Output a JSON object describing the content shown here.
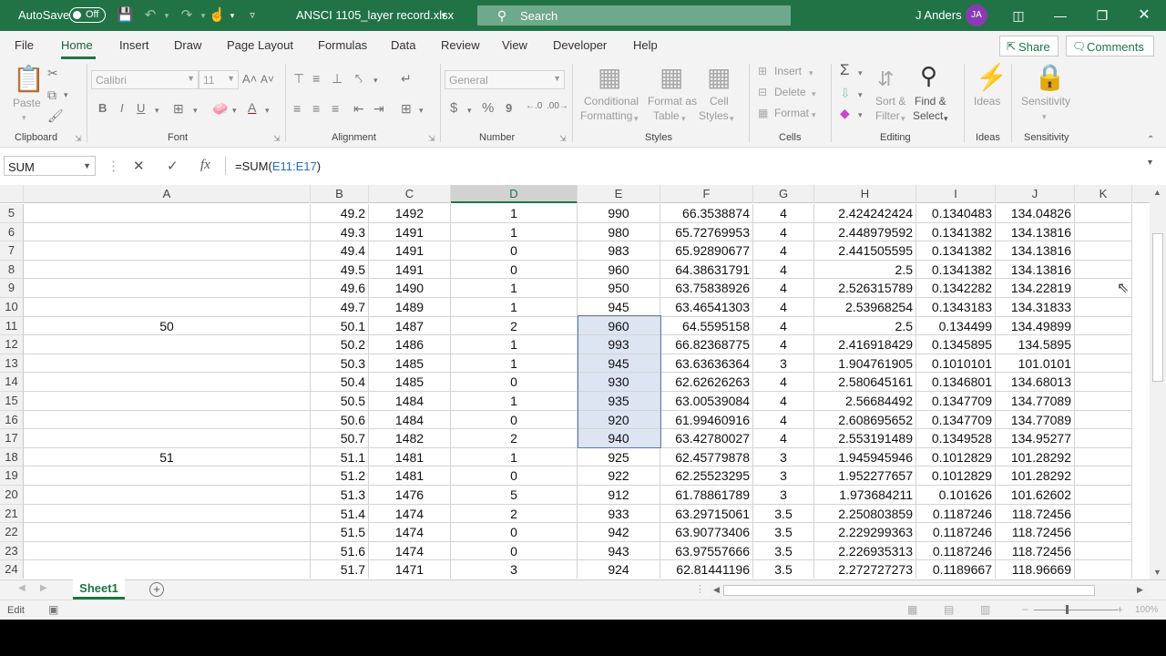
{
  "titlebar": {
    "autosave_label": "AutoSave",
    "autosave_state": "Off",
    "doc_title": "ANSCI 1105_layer record.xlsx",
    "search_placeholder": "Search",
    "user_name": "J Anders",
    "user_initials": "JA",
    "brand_color": "#217346"
  },
  "menu": {
    "tabs": [
      "File",
      "Home",
      "Insert",
      "Draw",
      "Page Layout",
      "Formulas",
      "Data",
      "Review",
      "View",
      "Developer",
      "Help"
    ],
    "active_tab": "Home",
    "share_label": "Share",
    "comments_label": "Comments"
  },
  "ribbon": {
    "clipboard": {
      "paste": "Paste",
      "label": "Clipboard"
    },
    "font": {
      "name": "Calibri",
      "size": "11",
      "label": "Font",
      "bold": "B",
      "italic": "I",
      "underline": "U"
    },
    "alignment": {
      "label": "Alignment"
    },
    "number": {
      "format": "General",
      "label": "Number",
      "currency": "$",
      "percent": "%",
      "comma": "9"
    },
    "styles": {
      "conditional_1": "Conditional",
      "conditional_2": "Formatting",
      "format_table_1": "Format as",
      "format_table_2": "Table",
      "cell_styles_1": "Cell",
      "cell_styles_2": "Styles",
      "label": "Styles"
    },
    "cells": {
      "insert": "Insert",
      "delete": "Delete",
      "format": "Format",
      "label": "Cells"
    },
    "editing": {
      "sort_1": "Sort &",
      "sort_2": "Filter",
      "find_1": "Find &",
      "find_2": "Select",
      "label": "Editing"
    },
    "ideas": {
      "button": "Ideas",
      "label": "Ideas"
    },
    "sensitivity": {
      "button": "Sensitivity",
      "label": "Sensitivity"
    }
  },
  "formula_bar": {
    "name_box": "SUM",
    "formula_prefix": "=SUM(",
    "formula_ref": "E11:E17",
    "formula_suffix": ")",
    "fx": "fx"
  },
  "sheet": {
    "columns": [
      "A",
      "B",
      "C",
      "D",
      "E",
      "F",
      "G",
      "H",
      "I",
      "J",
      "K"
    ],
    "selected_column": "D",
    "rows": [
      {
        "n": "5",
        "A": "",
        "B": "49.2",
        "C": "1492",
        "D": "1",
        "E": "990",
        "F": "66.3538874",
        "G": "4",
        "H": "2.424242424",
        "I": "0.1340483",
        "J": "134.04826"
      },
      {
        "n": "6",
        "A": "",
        "B": "49.3",
        "C": "1491",
        "D": "1",
        "E": "980",
        "F": "65.72769953",
        "G": "4",
        "H": "2.448979592",
        "I": "0.1341382",
        "J": "134.13816"
      },
      {
        "n": "7",
        "A": "",
        "B": "49.4",
        "C": "1491",
        "D": "0",
        "E": "983",
        "F": "65.92890677",
        "G": "4",
        "H": "2.441505595",
        "I": "0.1341382",
        "J": "134.13816"
      },
      {
        "n": "8",
        "A": "",
        "B": "49.5",
        "C": "1491",
        "D": "0",
        "E": "960",
        "F": "64.38631791",
        "G": "4",
        "H": "2.5",
        "I": "0.1341382",
        "J": "134.13816"
      },
      {
        "n": "9",
        "A": "",
        "B": "49.6",
        "C": "1490",
        "D": "1",
        "E": "950",
        "F": "63.75838926",
        "G": "4",
        "H": "2.526315789",
        "I": "0.1342282",
        "J": "134.22819"
      },
      {
        "n": "10",
        "A": "",
        "B": "49.7",
        "C": "1489",
        "D": "1",
        "E": "945",
        "F": "63.46541303",
        "G": "4",
        "H": "2.53968254",
        "I": "0.1343183",
        "J": "134.31833"
      },
      {
        "n": "11",
        "A": "50",
        "B": "50.1",
        "C": "1487",
        "D": "2",
        "E": "960",
        "F": "64.5595158",
        "G": "4",
        "H": "2.5",
        "I": "0.134499",
        "J": "134.49899"
      },
      {
        "n": "12",
        "A": "",
        "B": "50.2",
        "C": "1486",
        "D": "1",
        "E": "993",
        "F": "66.82368775",
        "G": "4",
        "H": "2.416918429",
        "I": "0.1345895",
        "J": "134.5895"
      },
      {
        "n": "13",
        "A": "",
        "B": "50.3",
        "C": "1485",
        "D": "1",
        "E": "945",
        "F": "63.63636364",
        "G": "3",
        "H": "1.904761905",
        "I": "0.1010101",
        "J": "101.0101"
      },
      {
        "n": "14",
        "A": "",
        "B": "50.4",
        "C": "1485",
        "D": "0",
        "E": "930",
        "F": "62.62626263",
        "G": "4",
        "H": "2.580645161",
        "I": "0.1346801",
        "J": "134.68013"
      },
      {
        "n": "15",
        "A": "",
        "B": "50.5",
        "C": "1484",
        "D": "1",
        "E": "935",
        "F": "63.00539084",
        "G": "4",
        "H": "2.56684492",
        "I": "0.1347709",
        "J": "134.77089"
      },
      {
        "n": "16",
        "A": "",
        "B": "50.6",
        "C": "1484",
        "D": "0",
        "E": "920",
        "F": "61.99460916",
        "G": "4",
        "H": "2.608695652",
        "I": "0.1347709",
        "J": "134.77089"
      },
      {
        "n": "17",
        "A": "",
        "B": "50.7",
        "C": "1482",
        "D": "2",
        "E": "940",
        "F": "63.42780027",
        "G": "4",
        "H": "2.553191489",
        "I": "0.1349528",
        "J": "134.95277"
      },
      {
        "n": "18",
        "A": "51",
        "B": "51.1",
        "C": "1481",
        "D": "1",
        "E": "925",
        "F": "62.45779878",
        "G": "3",
        "H": "1.945945946",
        "I": "0.1012829",
        "J": "101.28292"
      },
      {
        "n": "19",
        "A": "",
        "B": "51.2",
        "C": "1481",
        "D": "0",
        "E": "922",
        "F": "62.25523295",
        "G": "3",
        "H": "1.952277657",
        "I": "0.1012829",
        "J": "101.28292"
      },
      {
        "n": "20",
        "A": "",
        "B": "51.3",
        "C": "1476",
        "D": "5",
        "E": "912",
        "F": "61.78861789",
        "G": "3",
        "H": "1.973684211",
        "I": "0.101626",
        "J": "101.62602"
      },
      {
        "n": "21",
        "A": "",
        "B": "51.4",
        "C": "1474",
        "D": "2",
        "E": "933",
        "F": "63.29715061",
        "G": "3.5",
        "H": "2.250803859",
        "I": "0.1187246",
        "J": "118.72456"
      },
      {
        "n": "22",
        "A": "",
        "B": "51.5",
        "C": "1474",
        "D": "0",
        "E": "942",
        "F": "63.90773406",
        "G": "3.5",
        "H": "2.229299363",
        "I": "0.1187246",
        "J": "118.72456"
      },
      {
        "n": "23",
        "A": "",
        "B": "51.6",
        "C": "1474",
        "D": "0",
        "E": "943",
        "F": "63.97557666",
        "G": "3.5",
        "H": "2.226935313",
        "I": "0.1187246",
        "J": "118.72456"
      },
      {
        "n": "24",
        "A": "",
        "B": "51.7",
        "C": "1471",
        "D": "3",
        "E": "924",
        "F": "62.81441196",
        "G": "3.5",
        "H": "2.272727273",
        "I": "0.1189667",
        "J": "118.96669"
      }
    ],
    "selection_rows": [
      "11",
      "12",
      "13",
      "14",
      "15",
      "16",
      "17"
    ],
    "selection_column": "E"
  },
  "sheet_tabs": {
    "active": "Sheet1"
  },
  "status": {
    "mode": "Edit",
    "zoom": "100%"
  }
}
